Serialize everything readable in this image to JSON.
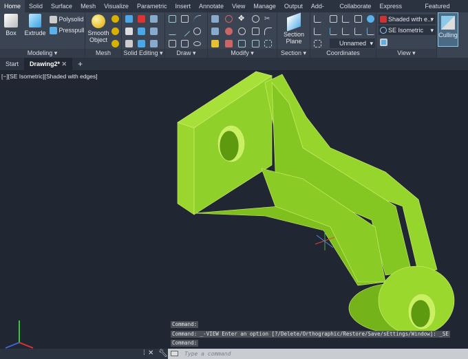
{
  "menu_tabs": [
    "Home",
    "Solid",
    "Surface",
    "Mesh",
    "Visualize",
    "Parametric",
    "Insert",
    "Annotate",
    "View",
    "Manage",
    "Output",
    "Add-ins",
    "Collaborate",
    "Express Tools",
    "Featured Apps"
  ],
  "ribbon": {
    "modeling": {
      "label": "Modeling",
      "box": "Box",
      "extrude": "Extrude",
      "polysolid": "Polysolid",
      "presspull": "Presspull"
    },
    "mesh": {
      "label": "Mesh",
      "smooth": "Smooth",
      "object": "Object"
    },
    "solid_editing": {
      "label": "Solid Editing"
    },
    "draw": {
      "label": "Draw"
    },
    "modify": {
      "label": "Modify"
    },
    "section": {
      "label": "Section",
      "section": "Section",
      "plane": "Plane"
    },
    "coordinates": {
      "label": "Coordinates",
      "ucs": "Unnamed"
    },
    "view": {
      "label": "View",
      "visual_style": "Shaded with e...",
      "viewpoint": "SE Isometric"
    },
    "culling": "Culling"
  },
  "doc_tabs": {
    "start": "Start",
    "drawing": "Drawing2*",
    "close": "✕",
    "add": "+"
  },
  "viewport_label": "[−][SE Isometric][Shaded with edges]",
  "command": {
    "history": [
      "Command:",
      "Command: _-VIEW Enter an option [?/Delete/Orthographic/Restore/Save/sEttings/Window]: _SE",
      "Command:"
    ],
    "placeholder": "Type a command"
  },
  "colors": {
    "model": "#8fd12a",
    "viewport": "#212633",
    "ribbon": "#3b4453"
  }
}
